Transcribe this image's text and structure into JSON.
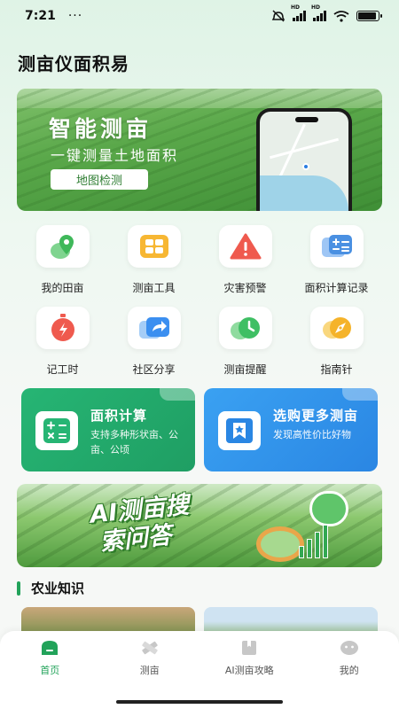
{
  "status_bar": {
    "time": "7:21",
    "dots": "···",
    "hd1": "HD",
    "hd2": "HD",
    "battery_level": 0.9
  },
  "app_title": "测亩仪面积易",
  "banner": {
    "title": "智能测亩",
    "subtitle": "一键测量土地面积",
    "button": "地图检测"
  },
  "features": [
    {
      "label": "我的田亩",
      "icon": "map-pin-icon",
      "color": "#4cc26a"
    },
    {
      "label": "测亩工具",
      "icon": "tools-grid-icon",
      "color": "#f5a623"
    },
    {
      "label": "灾害预警",
      "icon": "warning-icon",
      "color": "#ef5a4e"
    },
    {
      "label": "面积计算记录",
      "icon": "calculator-record-icon",
      "color": "#4a90e2"
    },
    {
      "label": "记工时",
      "icon": "stopwatch-icon",
      "color": "#ef5a4e"
    },
    {
      "label": "社区分享",
      "icon": "share-icon",
      "color": "#3b8ff0"
    },
    {
      "label": "测亩提醒",
      "icon": "clock-icon",
      "color": "#3fbf64"
    },
    {
      "label": "指南针",
      "icon": "compass-icon",
      "color": "#f5b32a"
    }
  ],
  "cards": {
    "area": {
      "title": "面积计算",
      "desc": "支持多种形状亩、公亩、公顷"
    },
    "buy": {
      "title": "选购更多测亩",
      "desc": "发现高性价比好物"
    }
  },
  "ai_banner": {
    "line1": "AI测亩搜",
    "line2": "索问答"
  },
  "section": {
    "title": "农业知识"
  },
  "tabbar": [
    {
      "label": "首页",
      "icon": "home-icon",
      "active": true
    },
    {
      "label": "测亩",
      "icon": "ruler-icon",
      "active": false
    },
    {
      "label": "AI测亩攻略",
      "icon": "guide-book-icon",
      "active": false
    },
    {
      "label": "我的",
      "icon": "profile-icon",
      "active": false
    }
  ],
  "colors": {
    "accent": "#22a35a",
    "card_green": "#26b574",
    "card_blue": "#3aa1f2"
  }
}
